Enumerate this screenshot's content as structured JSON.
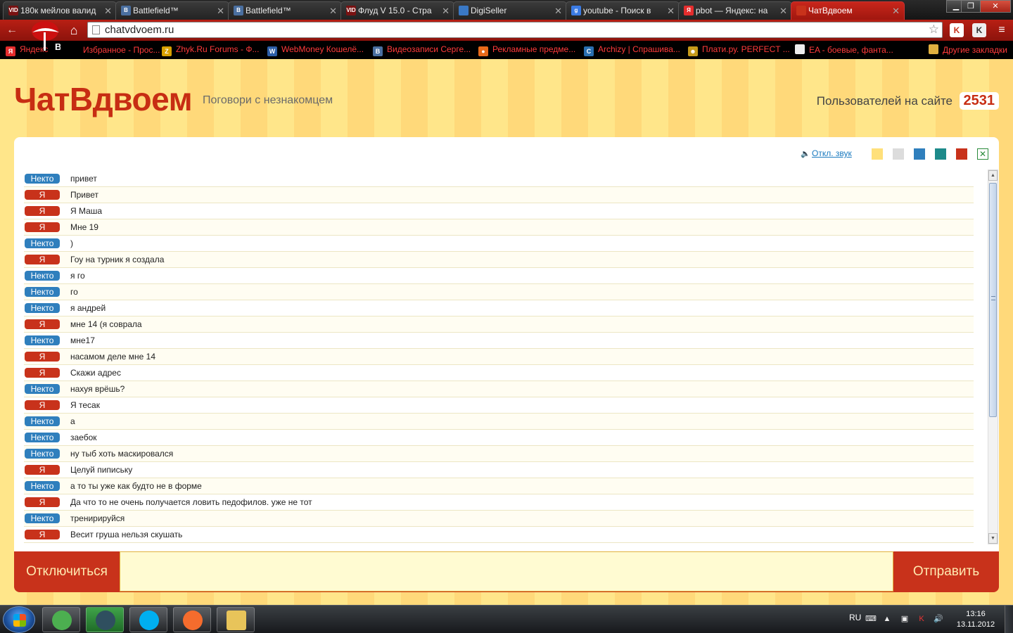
{
  "browser": {
    "tabs": [
      {
        "title": "180к мейлов валид",
        "favicon": "vid-hack-favicon",
        "fav_color": "#7a1212",
        "fav_text": "VID"
      },
      {
        "title": "Battlefield™",
        "favicon": "vk-favicon",
        "fav_color": "#4a6fa0",
        "fav_text": "В"
      },
      {
        "title": "Battlefield™",
        "favicon": "vk-favicon",
        "fav_color": "#4a6fa0",
        "fav_text": "В"
      },
      {
        "title": "Флуд V 15.0 - Стра",
        "favicon": "vid-hack-favicon",
        "fav_color": "#7a1212",
        "fav_text": "VID"
      },
      {
        "title": "DigiSeller",
        "favicon": "digiseller-favicon",
        "fav_color": "#3a78c4",
        "fav_text": ""
      },
      {
        "title": "youtube - Поиск в",
        "favicon": "google-favicon",
        "fav_color": "#3b7be3",
        "fav_text": "g"
      },
      {
        "title": "pbot — Яндекс: на",
        "favicon": "yandex-favicon",
        "fav_color": "#e52d2d",
        "fav_text": "Я"
      },
      {
        "title": "ЧатВдвоем",
        "favicon": "chatvdvoem-favicon",
        "fav_color": "#c8321b",
        "fav_text": ""
      }
    ],
    "address": "chatvdvoem.ru",
    "bookmarks": [
      {
        "label": "Яндекс",
        "icon_color": "#e52d2d",
        "icon_text": "Я"
      },
      {
        "label": "Избранное - Прос...",
        "icon_color": "#000",
        "icon_text": ""
      },
      {
        "label": "Zhyk.Ru Forums - Ф...",
        "icon_color": "#d8a000",
        "icon_text": "Z"
      },
      {
        "label": "WebMoney Кошелё...",
        "icon_color": "#2d5fa8",
        "icon_text": "W"
      },
      {
        "label": "Видеозаписи Серге...",
        "icon_color": "#4a6fa0",
        "icon_text": "В"
      },
      {
        "label": "Рекламные предме...",
        "icon_color": "#e86a1a",
        "icon_text": "●"
      },
      {
        "label": "Archizy | Спрашива...",
        "icon_color": "#2a6fb0",
        "icon_text": "C"
      },
      {
        "label": "Плати.ру. PERFECT ...",
        "icon_color": "#c49a1a",
        "icon_text": "☻"
      },
      {
        "label": "EA - боевые, фанта...",
        "icon_color": "#eee",
        "icon_text": ""
      },
      {
        "label": "Другие закладки",
        "icon_color": "#e0b040",
        "icon_text": ""
      }
    ]
  },
  "site": {
    "logo": "ЧатВдвоем",
    "tagline": "Поговори с незнакомцем",
    "users_label": "Пользователей на сайте",
    "users_count": "2531",
    "sound_toggle": "Откл. звук",
    "theme_swatches": [
      {
        "name": "yellow",
        "color": "#ffe07a"
      },
      {
        "name": "grey",
        "color": "#dcdcdc"
      },
      {
        "name": "blue",
        "color": "#2f7fbd"
      },
      {
        "name": "teal",
        "color": "#1d8a8a"
      },
      {
        "name": "red",
        "color": "#c8321b"
      }
    ],
    "disconnect_label": "Отключиться",
    "send_label": "Отправить",
    "input_value": ""
  },
  "messages": [
    {
      "who": "Некто",
      "role": "stranger",
      "text": "привет"
    },
    {
      "who": "Я",
      "role": "me",
      "text": "Привет"
    },
    {
      "who": "Я",
      "role": "me",
      "text": "Я Маша"
    },
    {
      "who": "Я",
      "role": "me",
      "text": "Мне 19"
    },
    {
      "who": "Некто",
      "role": "stranger",
      "text": ")"
    },
    {
      "who": "Я",
      "role": "me",
      "text": "Гоу на турник я создала"
    },
    {
      "who": "Некто",
      "role": "stranger",
      "text": "я го"
    },
    {
      "who": "Некто",
      "role": "stranger",
      "text": "го"
    },
    {
      "who": "Некто",
      "role": "stranger",
      "text": "я андрей"
    },
    {
      "who": "Я",
      "role": "me",
      "text": "мне 14 (я соврала"
    },
    {
      "who": "Некто",
      "role": "stranger",
      "text": "мне17"
    },
    {
      "who": "Я",
      "role": "me",
      "text": "насамом деле мне 14"
    },
    {
      "who": "Я",
      "role": "me",
      "text": "Скажи адрес"
    },
    {
      "who": "Некто",
      "role": "stranger",
      "text": "нахуя врёшь?"
    },
    {
      "who": "Я",
      "role": "me",
      "text": "Я тесак"
    },
    {
      "who": "Некто",
      "role": "stranger",
      "text": "а"
    },
    {
      "who": "Некто",
      "role": "stranger",
      "text": "заебок"
    },
    {
      "who": "Некто",
      "role": "stranger",
      "text": "ну тыб хоть маскировался"
    },
    {
      "who": "Я",
      "role": "me",
      "text": "Целуй пипиську"
    },
    {
      "who": "Некто",
      "role": "stranger",
      "text": "а то ты уже как будто не в форме"
    },
    {
      "who": "Я",
      "role": "me",
      "text": "Да что то не очень получается ловить педофилов. уже не тот"
    },
    {
      "who": "Некто",
      "role": "stranger",
      "text": "тренирируйся"
    },
    {
      "who": "Я",
      "role": "me",
      "text": "Весит груша нельзя скушать"
    }
  ],
  "taskbar": {
    "apps": [
      {
        "name": "chrome",
        "color": "#4caf50"
      },
      {
        "name": "steam",
        "color": "#2f4f5f"
      },
      {
        "name": "skype",
        "color": "#00aff0"
      },
      {
        "name": "origin",
        "color": "#f56c2d"
      },
      {
        "name": "file-explorer",
        "color": "#e8c45a"
      }
    ],
    "language": "RU",
    "time": "13:16",
    "date": "13.11.2012"
  }
}
